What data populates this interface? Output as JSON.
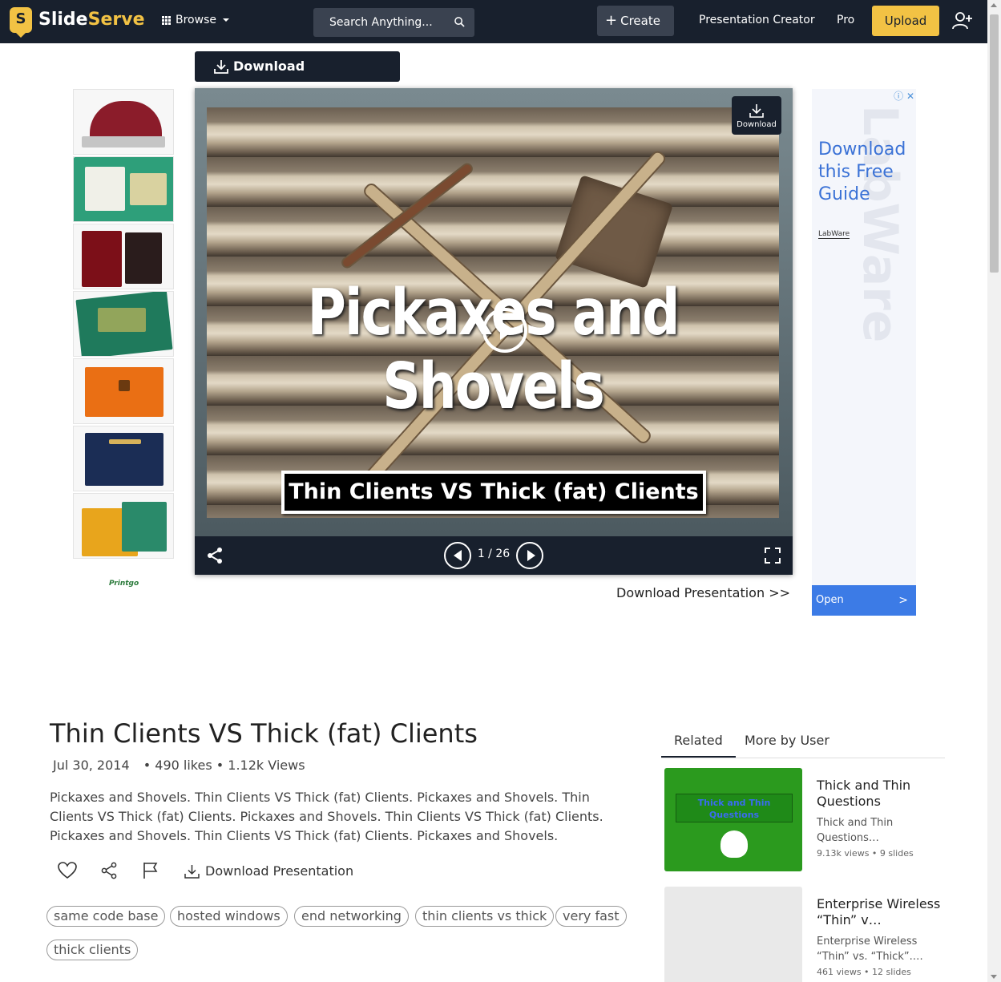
{
  "nav": {
    "logo_letter": "S",
    "logo_part1": "Slide",
    "logo_part2": "Serve",
    "browse": "Browse",
    "search_placeholder": "Search Anything...",
    "create": "Create",
    "presentation_creator": "Presentation Creator",
    "pro": "Pro",
    "upload": "Upload"
  },
  "top_download_label": "Download Presentation",
  "viewer": {
    "slide_title": "Pickaxes and Shovels",
    "slide_subtitle": "Thin Clients VS Thick (fat) Clients",
    "download_badge": "Download",
    "current_slide": 1,
    "total_slides": 26,
    "page_counter": "1 / 26"
  },
  "download_link": "Download Presentation >>",
  "ad_left": {
    "brand": "Printgo"
  },
  "ad_right": {
    "headline": "Download this Free Guide",
    "brand": "LabWare",
    "watermark": "LabWare",
    "open_label": "Open"
  },
  "presentation": {
    "title": "Thin Clients VS Thick (fat) Clients",
    "date": "Jul 30, 2014",
    "stats": "• 490 likes • 1.12k Views",
    "description": "Pickaxes and Shovels. Thin Clients VS Thick (fat) Clients. Pickaxes and Shovels. Thin Clients VS Thick (fat) Clients. Pickaxes and Shovels. Thin Clients VS Thick (fat) Clients. Pickaxes and Shovels. Thin Clients VS Thick (fat) Clients. Pickaxes and Shovels.",
    "download_label": "Download Presentation",
    "tags": [
      "same code base",
      "hosted windows",
      "end networking",
      "thin clients vs thick",
      "very fast",
      "thick clients"
    ]
  },
  "sidebar": {
    "tabs": [
      "Related",
      "More by User"
    ],
    "related": [
      {
        "title": "Thick and Thin Questions",
        "thumb_text": "Thick and Thin Questions",
        "description": "Thick and Thin Questions…",
        "stats": "9.13k views • 9 slides"
      },
      {
        "title": "Enterprise Wireless “Thin” v…",
        "description": "Enterprise Wireless “Thin” vs. “Thick”.…",
        "stats": "461 views • 12 slides"
      }
    ]
  },
  "colors": {
    "nav_bg": "#18202d",
    "brand_yellow": "#f2c244",
    "ad_blue": "#3c7be6"
  }
}
